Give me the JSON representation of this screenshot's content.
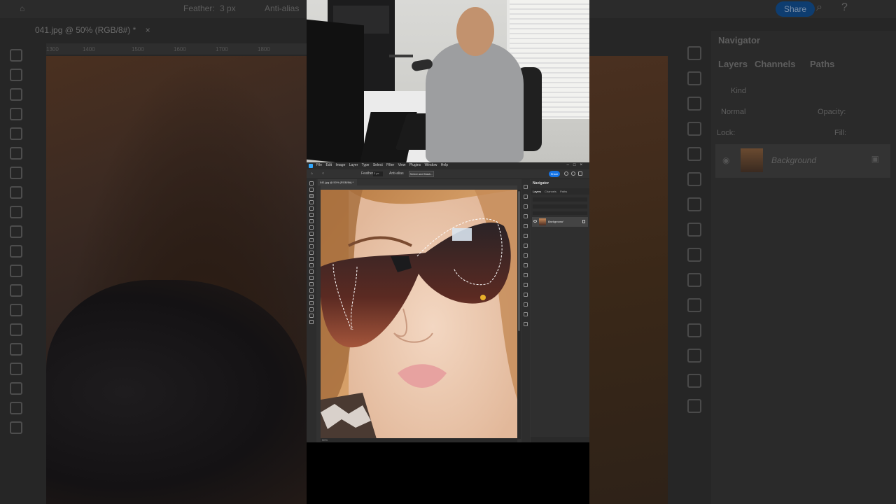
{
  "background_ui": {
    "feather_label": "Feather:",
    "feather_value": "3 px",
    "anti_alias_label": "Anti-alias",
    "share_label": "Share",
    "doc_tab": "041.jpg @ 50% (RGB/8#) *",
    "ruler_ticks": [
      "1300",
      "1400",
      "1500",
      "1600",
      "1700",
      "1800"
    ],
    "right_panel": {
      "navigator_title": "Navigator",
      "tabs": [
        "Layers",
        "Channels",
        "Paths"
      ],
      "kind_label": "Kind",
      "blend_mode": "Normal",
      "opacity_label": "Opacity:",
      "lock_label": "Lock:",
      "fill_label": "Fill:",
      "layer_name": "Background"
    }
  },
  "mini_ps": {
    "menu": [
      "File",
      "Edit",
      "Image",
      "Layer",
      "Type",
      "Select",
      "Filter",
      "View",
      "Plugins",
      "Window",
      "Help"
    ],
    "feather_label": "Feather:",
    "feather_value": "3 px",
    "anti_alias_label": "Anti-alias",
    "select_mask_label": "Select and Mask...",
    "share_label": "Share",
    "doc_tab": "041.jpg @ 50% (RGB/8#) *",
    "zoom_status": "50%",
    "panel": {
      "navigator_title": "Navigator",
      "tabs": [
        "Layers",
        "Channels",
        "Paths"
      ],
      "layer_name": "Background"
    }
  },
  "colors": {
    "accent": "#1473e6",
    "ps_dark": "#323232",
    "background_dark": "#262626"
  }
}
